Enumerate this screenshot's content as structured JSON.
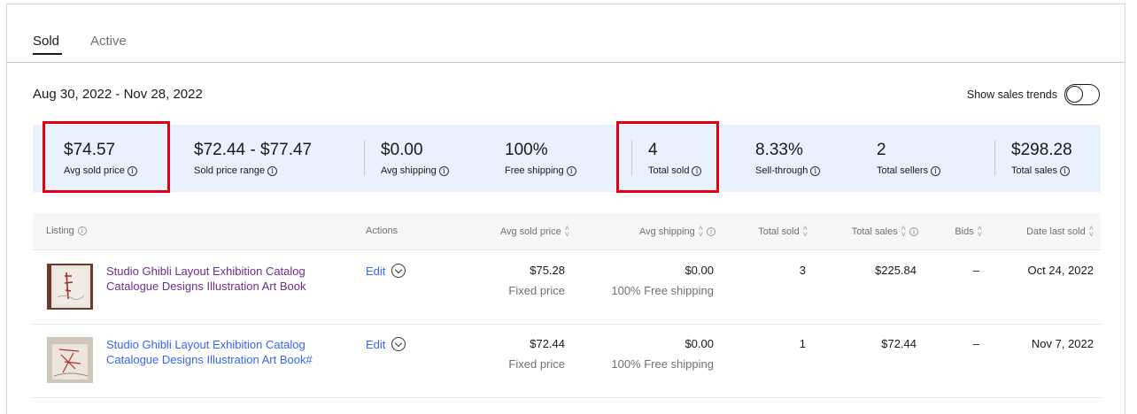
{
  "tabs": {
    "sold": "Sold",
    "active": "Active"
  },
  "date_range": "Aug 30, 2022 - Nov 28, 2022",
  "sales_trends": {
    "label": "Show sales trends",
    "on": false
  },
  "stats": [
    {
      "value": "$74.57",
      "label": "Avg sold price"
    },
    {
      "value": "$72.44 - $77.47",
      "label": "Sold price range"
    },
    {
      "value": "$0.00",
      "label": "Avg shipping"
    },
    {
      "value": "100%",
      "label": "Free shipping"
    },
    {
      "value": "4",
      "label": "Total sold"
    },
    {
      "value": "8.33%",
      "label": "Sell-through"
    },
    {
      "value": "2",
      "label": "Total sellers"
    },
    {
      "value": "$298.28",
      "label": "Total sales"
    }
  ],
  "highlight_color": "#e0000f",
  "table": {
    "headers": {
      "listing": "Listing",
      "actions": "Actions",
      "avg_sold_price": "Avg sold price",
      "avg_shipping": "Avg shipping",
      "total_sold": "Total sold",
      "total_sales": "Total sales",
      "bids": "Bids",
      "date_last_sold": "Date last sold"
    },
    "rows": [
      {
        "title": "Studio Ghibli Layout Exhibition Catalog Catalogue Designs Illustration Art Book",
        "action": "Edit",
        "price": "$75.28",
        "format": "Fixed price",
        "shipping": "$0.00",
        "shipping_note": "100% Free shipping",
        "total_sold": "3",
        "total_sales": "$225.84",
        "bids": "–",
        "date": "Oct 24, 2022"
      },
      {
        "title": "Studio Ghibli Layout Exhibition Catalog Catalogue Designs Illustration Art Book#",
        "action": "Edit",
        "price": "$72.44",
        "format": "Fixed price",
        "shipping": "$0.00",
        "shipping_note": "100% Free shipping",
        "total_sold": "1",
        "total_sales": "$72.44",
        "bids": "–",
        "date": "Nov 7, 2022"
      }
    ]
  }
}
